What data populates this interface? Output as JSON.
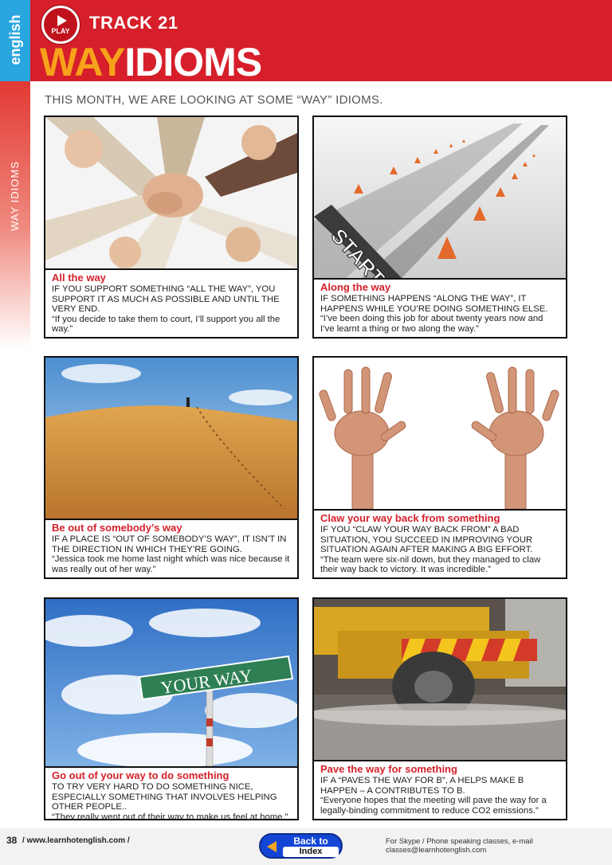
{
  "brand": {
    "logo_text": "english"
  },
  "header": {
    "play_label": "PLAY",
    "track": "TRACK 21",
    "title_part1": "WAY",
    "title_part2": "IDIOMS"
  },
  "side_label": "WAY IDIOMS",
  "subtitle": "THIS MONTH, WE ARE LOOKING AT SOME “WAY” IDIOMS.",
  "cards": [
    {
      "heading": "All the way",
      "definition": "IF YOU SUPPORT SOMETHING “ALL THE WAY”, YOU SUPPORT IT AS MUCH AS POSSIBLE AND UNTIL THE VERY END.",
      "example": "“If you decide to take them to court, I’ll support you all the way.”"
    },
    {
      "heading": "Along the way",
      "definition": "IF SOMETHING HAPPENS “ALONG THE WAY”, IT HAPPENS WHILE YOU’RE DOING SOMETHING ELSE.",
      "example": "“I’ve been doing this job for about twenty years now and I’ve learnt a thing or two along the way.”",
      "image_text": "START"
    },
    {
      "heading": "Be out of somebody’s way",
      "definition": "IF A PLACE IS “OUT OF SOMEBODY’S WAY”, IT ISN’T IN THE DIRECTION IN WHICH THEY’RE GOING.",
      "example": "“Jessica took me home last night which was nice because it was really out of her way.”"
    },
    {
      "heading": "Claw your way back from something",
      "definition": "IF YOU “CLAW YOUR WAY BACK FROM” A BAD SITUATION, YOU SUCCEED IN IMPROVING YOUR SITUATION AGAIN AFTER MAKING A BIG EFFORT.",
      "example": "“The team were six-nil down, but they managed to claw their way back to victory. It was incredible.”"
    },
    {
      "heading": "Go out of your way to do something",
      "definition": "TO TRY VERY HARD TO DO SOMETHING NICE, ESPECIALLY SOMETHING THAT INVOLVES HELPING OTHER PEOPLE..",
      "example": "“They really went out of their way to make us feel at home.”",
      "image_text": "YOUR WAY"
    },
    {
      "heading": "Pave the way for something",
      "definition": "IF A “PAVES THE WAY FOR B”, A HELPS MAKE B HAPPEN – A CONTRIBUTES TO B.",
      "example": "“Everyone hopes that the meeting will pave the way for a legally-binding commitment to reduce CO2 emissions.”"
    }
  ],
  "footer": {
    "page_number": "38",
    "url": "/ www.learnhotenglish.com /",
    "back_line1": "Back to",
    "back_line2": "Index",
    "contact": "For Skype / Phone speaking classes, e-mail classes@learnhotenglish.com"
  },
  "colors": {
    "header_red": "#d61f2a",
    "title_orange": "#f7a21b",
    "logo_blue": "#2aa6df",
    "back_button_blue": "#1446d6"
  }
}
